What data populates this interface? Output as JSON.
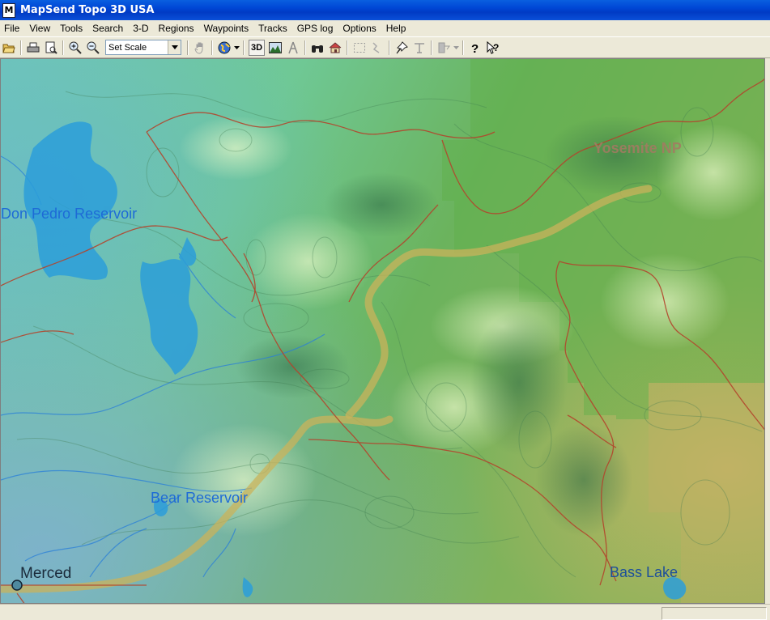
{
  "window": {
    "title": "MapSend Topo 3D USA",
    "icon_letter": "M"
  },
  "menu": {
    "items": [
      {
        "label": "File"
      },
      {
        "label": "View"
      },
      {
        "label": "Tools"
      },
      {
        "label": "Search"
      },
      {
        "label": "3-D"
      },
      {
        "label": "Regions"
      },
      {
        "label": "Waypoints"
      },
      {
        "label": "Tracks"
      },
      {
        "label": "GPS log"
      },
      {
        "label": "Options"
      },
      {
        "label": "Help"
      }
    ]
  },
  "toolbar": {
    "scale_select_value": "Set Scale",
    "three_d_label": "3D",
    "icons": [
      "open-folder-icon",
      "print-icon",
      "print-preview-icon",
      "zoom-in-icon",
      "zoom-out-icon",
      "hand-pan-icon",
      "globe-icon",
      "terrain-profile-icon",
      "compass-icon",
      "binoculars-icon",
      "home-icon",
      "select-area-icon",
      "route-icon",
      "waypoint-pin-icon",
      "route-tool-icon",
      "send-gps-icon",
      "help-icon",
      "context-help-icon"
    ]
  },
  "map": {
    "labels": {
      "yosemite": "Yosemite NP",
      "don_pedro": "Don Pedro Reservoir",
      "bear": "Bear Reservoir",
      "merced": "Merced",
      "bass_lake": "Bass Lake"
    },
    "colors": {
      "water": "#1e6bd6",
      "park": "#a57a62",
      "roads": "#b2452c"
    }
  },
  "status": {
    "text": ""
  }
}
